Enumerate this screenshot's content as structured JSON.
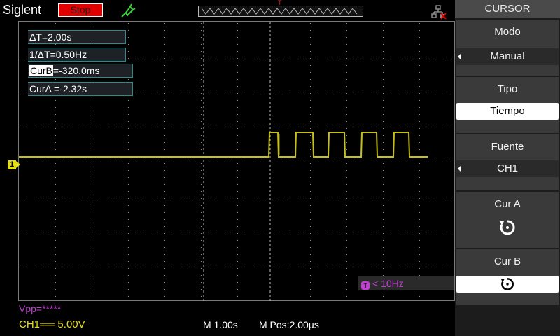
{
  "brand": "Siglent",
  "run_state": "Stop",
  "colors": {
    "run_state_bg": "#e00000",
    "ch1": "#e6dd1a",
    "trigger": "#c040d0",
    "menu_selected": "#ffffff"
  },
  "readouts": {
    "delta_t": "ΔT=2.00s",
    "inv_delta_t": "1/ΔT=0.50Hz",
    "cur_b_label": "CurB",
    "cur_b_value": "=-320.0ms",
    "cur_a": "CurA =-2.32s"
  },
  "channel_marker": "1",
  "trigger_freq": "< 10Hz",
  "status": {
    "vpp": "Vpp=*****",
    "ch1_scale": "CH1══ 5.00V",
    "timebase": "M 1.00s",
    "mpos": "M Pos:2.00µs"
  },
  "menu": {
    "title": "CURSOR",
    "items": [
      {
        "label": "Modo",
        "value": "Manual",
        "selected": false
      },
      {
        "label": "Tipo",
        "value": "Tiempo",
        "selected": true
      },
      {
        "label": "Fuente",
        "value": "CH1",
        "selected": false
      },
      {
        "label": "Cur A",
        "icon": "rotate-knob-icon",
        "selected": false
      },
      {
        "label": "Cur B",
        "icon": "rotate-knob-icon",
        "selected": true
      }
    ]
  },
  "icons": [
    "probe-icon",
    "network-disconnected-icon",
    "trigger-position-icon",
    "rotate-knob-icon"
  ]
}
